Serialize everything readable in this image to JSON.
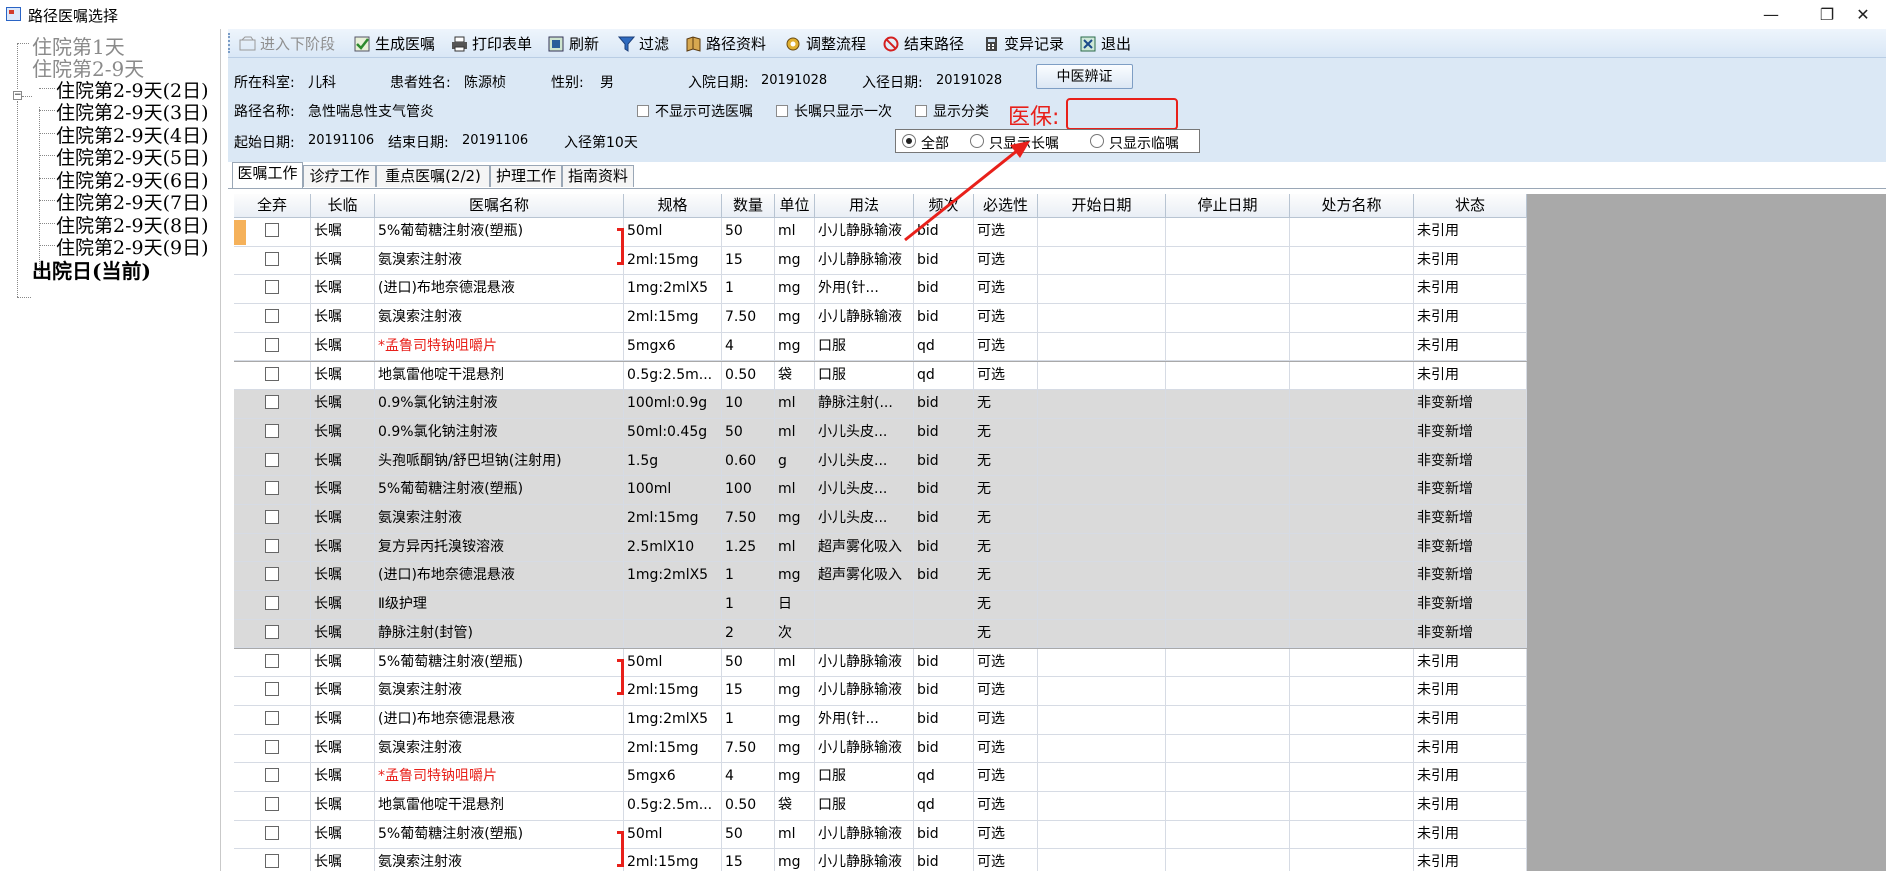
{
  "window": {
    "title": "路径医嘱选择",
    "min": "—",
    "restore": "❐",
    "close": "✕"
  },
  "tree": {
    "day1": "住院第1天",
    "day2_9": "住院第2-9天",
    "children": [
      "住院第2-9天(2日)",
      "住院第2-9天(3日)",
      "住院第2-9天(4日)",
      "住院第2-9天(5日)",
      "住院第2-9天(6日)",
      "住院第2-9天(7日)",
      "住院第2-9天(8日)",
      "住院第2-9天(9日)"
    ],
    "discharge": "出院日(当前)"
  },
  "toolbar": {
    "next_stage": "进入下阶段",
    "gen_orders": "生成医嘱",
    "print": "打印表单",
    "refresh": "刷新",
    "filter": "过滤",
    "path_info": "路径资料",
    "adjust_flow": "调整流程",
    "end_path": "结束路径",
    "variance": "变异记录",
    "exit": "退出"
  },
  "info": {
    "dept_label": "所在科室:",
    "dept": "儿科",
    "patient_label": "患者姓名:",
    "patient": "陈源桢",
    "gender_label": "性别:",
    "gender": "男",
    "admit_label": "入院日期:",
    "admit_date": "20191028",
    "path_in_label": "入径日期:",
    "path_in_date": "20191028",
    "tcm_button": "中医辨证",
    "path_name_label": "路径名称:",
    "path_name": "急性喘息性支气管炎",
    "hide_optional": "不显示可选医嘱",
    "long_once": "长嘱只显示一次",
    "show_category": "显示分类",
    "yibao_label": "医保:",
    "start_label": "起始日期:",
    "start_date": "20191106",
    "end_label": "结束日期:",
    "end_date": "20191106",
    "path_day": "入径第10天",
    "radio_all": "全部",
    "radio_long": "只显示长嘱",
    "radio_temp": "只显示临嘱"
  },
  "tabs": [
    "医嘱工作",
    "诊疗工作",
    "重点医嘱(2/2)",
    "护理工作",
    "指南资料"
  ],
  "grid": {
    "headers": [
      "全弃",
      "长临",
      "医嘱名称",
      "规格",
      "数量",
      "单位",
      "用法",
      "频次",
      "必选性",
      "开始日期",
      "停止日期",
      "处方名称",
      "状态"
    ],
    "rows": [
      [
        "长嘱",
        "5%葡萄糖注射液(塑瓶)",
        "50ml",
        "50",
        "ml",
        "小儿静脉输液",
        "bid",
        "可选",
        "未引用",
        "opt",
        ""
      ],
      [
        "长嘱",
        "氨溴索注射液",
        "2ml:15mg",
        "15",
        "mg",
        "小儿静脉输液",
        "bid",
        "可选",
        "未引用",
        "opt",
        ""
      ],
      [
        "长嘱",
        "(进口)布地奈德混悬液",
        "1mg:2mlX5",
        "1",
        "mg",
        "外用(针...",
        "bid",
        "可选",
        "未引用",
        "opt",
        ""
      ],
      [
        "长嘱",
        "氨溴索注射液",
        "2ml:15mg",
        "7.50",
        "mg",
        "小儿静脉输液",
        "bid",
        "可选",
        "未引用",
        "opt",
        ""
      ],
      [
        "长嘱",
        "*孟鲁司特钠咀嚼片",
        "5mgx6",
        "4",
        "mg",
        "口服",
        "qd",
        "可选",
        "未引用",
        "opt",
        "red"
      ],
      [
        "长嘱",
        "地氯雷他啶干混悬剂",
        "0.5g:2.5m...",
        "0.50",
        "袋",
        "口服",
        "qd",
        "可选",
        "未引用",
        "opt",
        ""
      ],
      [
        "长嘱",
        "0.9%氯化钠注射液",
        "100ml:0.9g",
        "10",
        "ml",
        "静脉注射(...",
        "bid",
        "无",
        "非变新增",
        "nonvar",
        ""
      ],
      [
        "长嘱",
        "0.9%氯化钠注射液",
        "50ml:0.45g",
        "50",
        "ml",
        "小儿头皮...",
        "bid",
        "无",
        "非变新增",
        "nonvar",
        ""
      ],
      [
        "长嘱",
        "头孢哌酮钠/舒巴坦钠(注射用)",
        "1.5g",
        "0.60",
        "g",
        "小儿头皮...",
        "bid",
        "无",
        "非变新增",
        "nonvar",
        ""
      ],
      [
        "长嘱",
        "5%葡萄糖注射液(塑瓶)",
        "100ml",
        "100",
        "ml",
        "小儿头皮...",
        "bid",
        "无",
        "非变新增",
        "nonvar",
        ""
      ],
      [
        "长嘱",
        "氨溴索注射液",
        "2ml:15mg",
        "7.50",
        "mg",
        "小儿头皮...",
        "bid",
        "无",
        "非变新增",
        "nonvar",
        ""
      ],
      [
        "长嘱",
        "复方异丙托溴铵溶液",
        "2.5mlX10",
        "1.25",
        "ml",
        "超声雾化吸入",
        "bid",
        "无",
        "非变新增",
        "nonvar",
        ""
      ],
      [
        "长嘱",
        "(进口)布地奈德混悬液",
        "1mg:2mlX5",
        "1",
        "mg",
        "超声雾化吸入",
        "bid",
        "无",
        "非变新增",
        "nonvar",
        ""
      ],
      [
        "长嘱",
        "Ⅱ级护理",
        "",
        "1",
        "日",
        "",
        "",
        "无",
        "非变新增",
        "nonvar",
        ""
      ],
      [
        "长嘱",
        "静脉注射(封管)",
        "",
        "2",
        "次",
        "",
        "",
        "无",
        "非变新增",
        "nonvar",
        ""
      ],
      [
        "长嘱",
        "5%葡萄糖注射液(塑瓶)",
        "50ml",
        "50",
        "ml",
        "小儿静脉输液",
        "bid",
        "可选",
        "未引用",
        "opt",
        ""
      ],
      [
        "长嘱",
        "氨溴索注射液",
        "2ml:15mg",
        "15",
        "mg",
        "小儿静脉输液",
        "bid",
        "可选",
        "未引用",
        "opt",
        ""
      ],
      [
        "长嘱",
        "(进口)布地奈德混悬液",
        "1mg:2mlX5",
        "1",
        "mg",
        "外用(针...",
        "bid",
        "可选",
        "未引用",
        "opt",
        ""
      ],
      [
        "长嘱",
        "氨溴索注射液",
        "2ml:15mg",
        "7.50",
        "mg",
        "小儿静脉输液",
        "bid",
        "可选",
        "未引用",
        "opt",
        ""
      ],
      [
        "长嘱",
        "*孟鲁司特钠咀嚼片",
        "5mgx6",
        "4",
        "mg",
        "口服",
        "qd",
        "可选",
        "未引用",
        "opt",
        "red"
      ],
      [
        "长嘱",
        "地氯雷他啶干混悬剂",
        "0.5g:2.5m...",
        "0.50",
        "袋",
        "口服",
        "qd",
        "可选",
        "未引用",
        "opt",
        ""
      ],
      [
        "长嘱",
        "5%葡萄糖注射液(塑瓶)",
        "50ml",
        "50",
        "ml",
        "小儿静脉输液",
        "bid",
        "可选",
        "未引用",
        "opt",
        ""
      ],
      [
        "长嘱",
        "氨溴索注射液",
        "2ml:15mg",
        "15",
        "mg",
        "小儿静脉输液",
        "bid",
        "可选",
        "未引用",
        "opt",
        ""
      ]
    ]
  },
  "colors": {
    "accent": "#e8201a",
    "panel": "#dbe8f5",
    "grid_bg": "#a9a9a9",
    "nonvar_row": "#dadada"
  }
}
